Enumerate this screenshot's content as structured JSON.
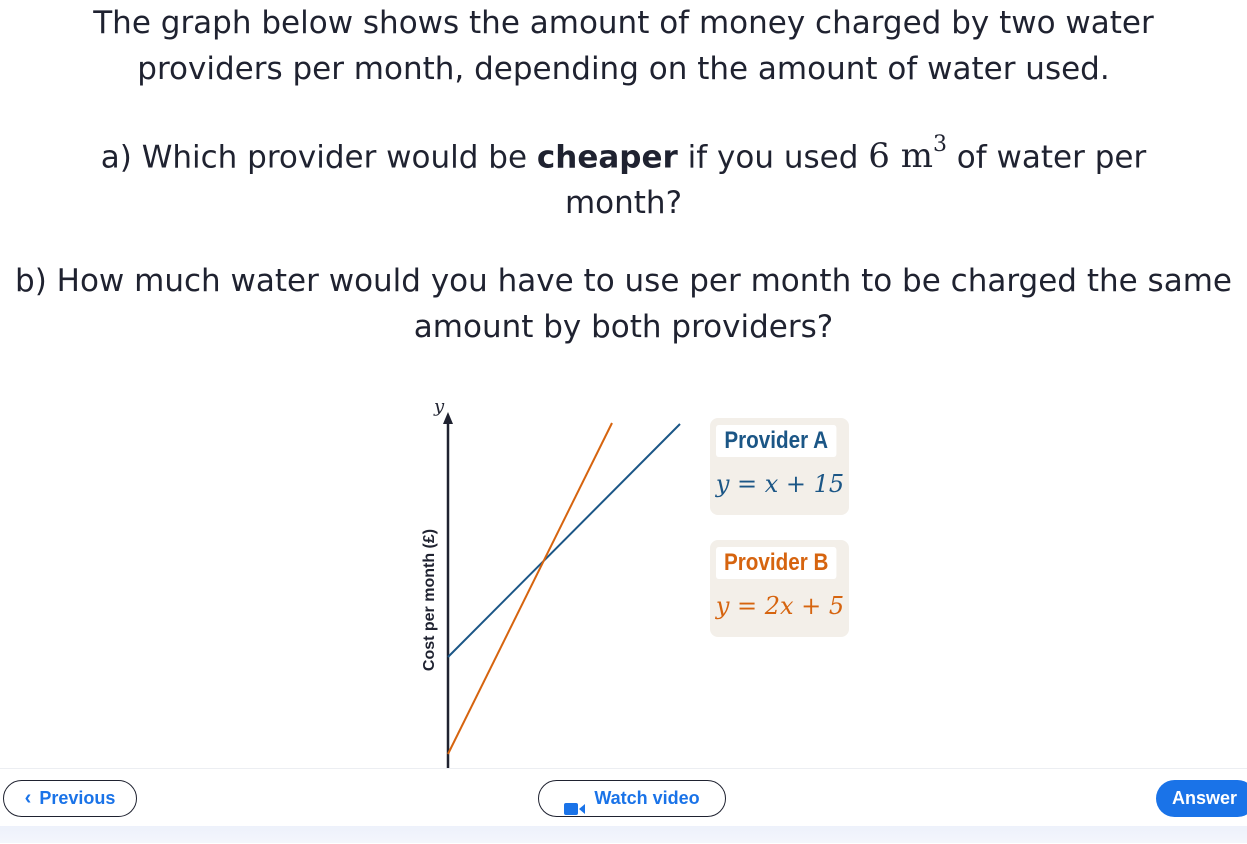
{
  "question": {
    "intro": "The graph below shows the amount of money charged by two water providers per month, depending on the amount of water used.",
    "part_a_prefix": "a) Which provider would be ",
    "part_a_bold": "cheaper",
    "part_a_middle": " if you used ",
    "part_a_math": "6 m",
    "part_a_exponent": "3",
    "part_a_suffix": " of water per month?",
    "part_b": "b) How much water would you have to use per month to be charged the same amount by both providers?"
  },
  "graph": {
    "y_axis_symbol": "y",
    "y_axis_label": "Cost per month (£)",
    "provider_a": {
      "name": "Provider A",
      "equation": "y = x + 15",
      "color": "#1b5686"
    },
    "provider_b": {
      "name": "Provider B",
      "equation": "y = 2x + 5",
      "color": "#d6640f"
    }
  },
  "nav": {
    "previous_label": "Previous",
    "video_label": "Watch video",
    "answer_label": "Answer",
    "accent_color": "#1a73e8"
  }
}
